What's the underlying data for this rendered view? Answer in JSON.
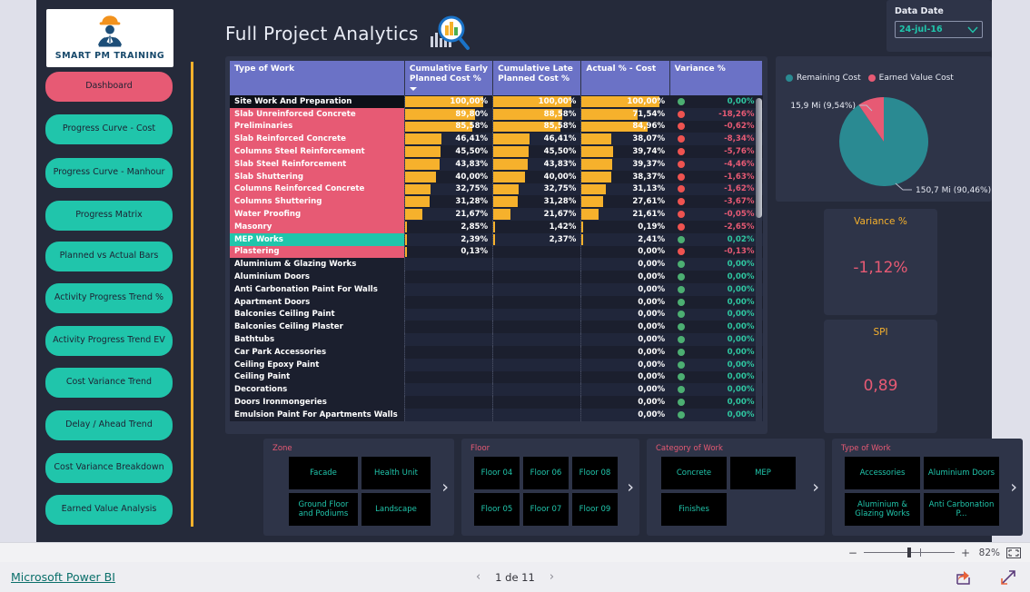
{
  "header": {
    "title": "Full Project Analytics",
    "title_icon": "magnifier-bar-chart-icon"
  },
  "sidebar": {
    "logo_text": "SMART PM TRAINING",
    "logo_icon": "hardhat-worker-icon",
    "items": [
      {
        "label": "Dashboard",
        "active": true
      },
      {
        "label": "Progress Curve - Cost",
        "active": false
      },
      {
        "label": "Progress Curve - Manhour",
        "active": false
      },
      {
        "label": "Progress Matrix",
        "active": false
      },
      {
        "label": "Planned vs Actual Bars",
        "active": false
      },
      {
        "label": "Activity Progress Trend %",
        "active": false
      },
      {
        "label": "Activity Progress Trend EV",
        "active": false
      },
      {
        "label": "Cost Variance Trend",
        "active": false
      },
      {
        "label": "Delay / Ahead Trend",
        "active": false
      },
      {
        "label": "Cost Variance Breakdown",
        "active": false
      },
      {
        "label": "Earned Value Analysis",
        "active": false
      }
    ]
  },
  "data_date": {
    "label": "Data Date",
    "value": "24-jul-16",
    "chevron_icon": "chevron-down-icon"
  },
  "table": {
    "columns": [
      "Type of Work",
      "Cumulative Early Planned Cost %",
      "Cumulative Late Planned Cost %",
      "Actual % - Cost",
      "Variance %"
    ],
    "sorted_column_index": 1,
    "rows": [
      {
        "name": "Site Work And Preparation",
        "cat": "dark",
        "early": "100,00%",
        "late": "100,00%",
        "actual": "100,00%",
        "variance": "0,00%",
        "status": "green",
        "early_v": 100.0,
        "late_v": 100.0,
        "actual_v": 100.0
      },
      {
        "name": "Slab Unreinforced Concrete",
        "cat": "pink",
        "early": "89,80%",
        "late": "88,58%",
        "actual": "71,54%",
        "variance": "-18,26%",
        "status": "red",
        "early_v": 89.8,
        "late_v": 88.58,
        "actual_v": 71.54
      },
      {
        "name": "Preliminaries",
        "cat": "pink",
        "early": "85,58%",
        "late": "85,58%",
        "actual": "84,96%",
        "variance": "-0,62%",
        "status": "red",
        "early_v": 85.58,
        "late_v": 85.58,
        "actual_v": 84.96
      },
      {
        "name": "Slab Reinforced Concrete",
        "cat": "pink",
        "early": "46,41%",
        "late": "46,41%",
        "actual": "38,07%",
        "variance": "-8,34%",
        "status": "red",
        "early_v": 46.41,
        "late_v": 46.41,
        "actual_v": 38.07
      },
      {
        "name": "Columns Steel Reinforcement",
        "cat": "pink",
        "early": "45,50%",
        "late": "45,50%",
        "actual": "39,74%",
        "variance": "-5,76%",
        "status": "red",
        "early_v": 45.5,
        "late_v": 45.5,
        "actual_v": 39.74
      },
      {
        "name": "Slab Steel Reinforcement",
        "cat": "pink",
        "early": "43,83%",
        "late": "43,83%",
        "actual": "39,37%",
        "variance": "-4,46%",
        "status": "red",
        "early_v": 43.83,
        "late_v": 43.83,
        "actual_v": 39.37
      },
      {
        "name": "Slab Shuttering",
        "cat": "pink",
        "early": "40,00%",
        "late": "40,00%",
        "actual": "38,37%",
        "variance": "-1,63%",
        "status": "red",
        "early_v": 40.0,
        "late_v": 40.0,
        "actual_v": 38.37
      },
      {
        "name": "Columns Reinforced Concrete",
        "cat": "pink",
        "early": "32,75%",
        "late": "32,75%",
        "actual": "31,13%",
        "variance": "-1,62%",
        "status": "red",
        "early_v": 32.75,
        "late_v": 32.75,
        "actual_v": 31.13
      },
      {
        "name": "Columns Shuttering",
        "cat": "pink",
        "early": "31,28%",
        "late": "31,28%",
        "actual": "27,61%",
        "variance": "-3,67%",
        "status": "red",
        "early_v": 31.28,
        "late_v": 31.28,
        "actual_v": 27.61
      },
      {
        "name": "Water Proofing",
        "cat": "pink",
        "early": "21,67%",
        "late": "21,67%",
        "actual": "21,61%",
        "variance": "-0,05%",
        "status": "red",
        "early_v": 21.67,
        "late_v": 21.67,
        "actual_v": 21.61
      },
      {
        "name": "Masonry",
        "cat": "pink",
        "early": "2,85%",
        "late": "1,42%",
        "actual": "0,19%",
        "variance": "-2,65%",
        "status": "red",
        "early_v": 2.85,
        "late_v": 1.42,
        "actual_v": 0.19
      },
      {
        "name": "MEP Works",
        "cat": "teal",
        "early": "2,39%",
        "late": "2,37%",
        "actual": "2,41%",
        "variance": "0,02%",
        "status": "green",
        "early_v": 2.39,
        "late_v": 2.37,
        "actual_v": 2.41
      },
      {
        "name": "Plastering",
        "cat": "pink",
        "early": "0,13%",
        "late": "",
        "actual": "0,00%",
        "variance": "-0,13%",
        "status": "red",
        "early_v": 0.13,
        "late_v": 0,
        "actual_v": 0
      },
      {
        "name": "Aluminium & Glazing Works",
        "cat": "none",
        "early": "",
        "late": "",
        "actual": "0,00%",
        "variance": "0,00%",
        "status": "green",
        "early_v": 0,
        "late_v": 0,
        "actual_v": 0
      },
      {
        "name": "Aluminium Doors",
        "cat": "none",
        "early": "",
        "late": "",
        "actual": "0,00%",
        "variance": "0,00%",
        "status": "green",
        "early_v": 0,
        "late_v": 0,
        "actual_v": 0
      },
      {
        "name": "Anti Carbonation Paint For Walls",
        "cat": "none",
        "early": "",
        "late": "",
        "actual": "0,00%",
        "variance": "0,00%",
        "status": "green",
        "early_v": 0,
        "late_v": 0,
        "actual_v": 0
      },
      {
        "name": "Apartment Doors",
        "cat": "none",
        "early": "",
        "late": "",
        "actual": "0,00%",
        "variance": "0,00%",
        "status": "green",
        "early_v": 0,
        "late_v": 0,
        "actual_v": 0
      },
      {
        "name": "Balconies Ceiling Paint",
        "cat": "none",
        "early": "",
        "late": "",
        "actual": "0,00%",
        "variance": "0,00%",
        "status": "green",
        "early_v": 0,
        "late_v": 0,
        "actual_v": 0
      },
      {
        "name": "Balconies Ceiling Plaster",
        "cat": "none",
        "early": "",
        "late": "",
        "actual": "0,00%",
        "variance": "0,00%",
        "status": "green",
        "early_v": 0,
        "late_v": 0,
        "actual_v": 0
      },
      {
        "name": "Bathtubs",
        "cat": "none",
        "early": "",
        "late": "",
        "actual": "0,00%",
        "variance": "0,00%",
        "status": "green",
        "early_v": 0,
        "late_v": 0,
        "actual_v": 0
      },
      {
        "name": "Car Park Accessories",
        "cat": "none",
        "early": "",
        "late": "",
        "actual": "0,00%",
        "variance": "0,00%",
        "status": "green",
        "early_v": 0,
        "late_v": 0,
        "actual_v": 0
      },
      {
        "name": "Ceiling Epoxy Paint",
        "cat": "none",
        "early": "",
        "late": "",
        "actual": "0,00%",
        "variance": "0,00%",
        "status": "green",
        "early_v": 0,
        "late_v": 0,
        "actual_v": 0
      },
      {
        "name": "Ceiling Paint",
        "cat": "none",
        "early": "",
        "late": "",
        "actual": "0,00%",
        "variance": "0,00%",
        "status": "green",
        "early_v": 0,
        "late_v": 0,
        "actual_v": 0
      },
      {
        "name": "Decorations",
        "cat": "none",
        "early": "",
        "late": "",
        "actual": "0,00%",
        "variance": "0,00%",
        "status": "green",
        "early_v": 0,
        "late_v": 0,
        "actual_v": 0
      },
      {
        "name": "Doors Ironmongeries",
        "cat": "none",
        "early": "",
        "late": "",
        "actual": "0,00%",
        "variance": "0,00%",
        "status": "green",
        "early_v": 0,
        "late_v": 0,
        "actual_v": 0
      },
      {
        "name": "Emulsion Paint For Apartments Walls",
        "cat": "none",
        "early": "",
        "late": "",
        "actual": "0,00%",
        "variance": "0,00%",
        "status": "green",
        "early_v": 0,
        "late_v": 0,
        "actual_v": 0
      }
    ]
  },
  "chart_data": {
    "type": "pie",
    "title": "",
    "legend_position": "top-left",
    "legend": [
      "Remaining Cost",
      "Earned Value Cost"
    ],
    "categories": [
      "Remaining Cost",
      "Earned Value Cost"
    ],
    "values": [
      150.7,
      15.9
    ],
    "percentages": [
      90.46,
      9.54
    ],
    "labels": [
      "150,7 Mi (90,46%)",
      "15,9 Mi (9,54%)"
    ],
    "colors": [
      "#2a8a92",
      "#e75a74"
    ]
  },
  "kpis": [
    {
      "title": "Variance %",
      "value": "-1,12%"
    },
    {
      "title": "SPI",
      "value": "0,89"
    }
  ],
  "slicers": [
    {
      "title": "Zone",
      "tiles": [
        "Facade",
        "Health Unit",
        "Ground Floor and Podiums",
        "Landscape"
      ],
      "arrow_icon": "chevron-right-icon"
    },
    {
      "title": "Floor",
      "tiles": [
        "Floor 04",
        "Floor 06",
        "Floor 08",
        "Floor 05",
        "Floor 07",
        "Floor 09"
      ],
      "arrow_icon": "chevron-right-icon"
    },
    {
      "title": "Category of Work",
      "tiles": [
        "Concrete",
        "MEP",
        "Finishes",
        ""
      ],
      "arrow_icon": "chevron-right-icon"
    },
    {
      "title": "Type of Work",
      "tiles": [
        "Accessories",
        "Aluminium Doors",
        "Aluminium & Glazing Works",
        "Anti Carbonation P..."
      ],
      "arrow_icon": "chevron-right-icon"
    }
  ],
  "zoombar": {
    "minus": "−",
    "plus": "+",
    "percent": "82%",
    "fit_icon": "fit-to-page-icon"
  },
  "footer": {
    "brand": "Microsoft Power BI",
    "prev_icon": "chevron-left-icon",
    "next_icon": "chevron-right-icon",
    "page_text": "1 de 11",
    "share_icon": "share-icon",
    "fullscreen_icon": "fullscreen-icon"
  },
  "colors": {
    "accent_teal": "#20c5ab",
    "accent_pink": "#e75a74",
    "accent_orange": "#f6b12c",
    "header_purple": "#6b72c6",
    "canvas_bg": "#252a3a",
    "card_bg": "#2e3448"
  }
}
